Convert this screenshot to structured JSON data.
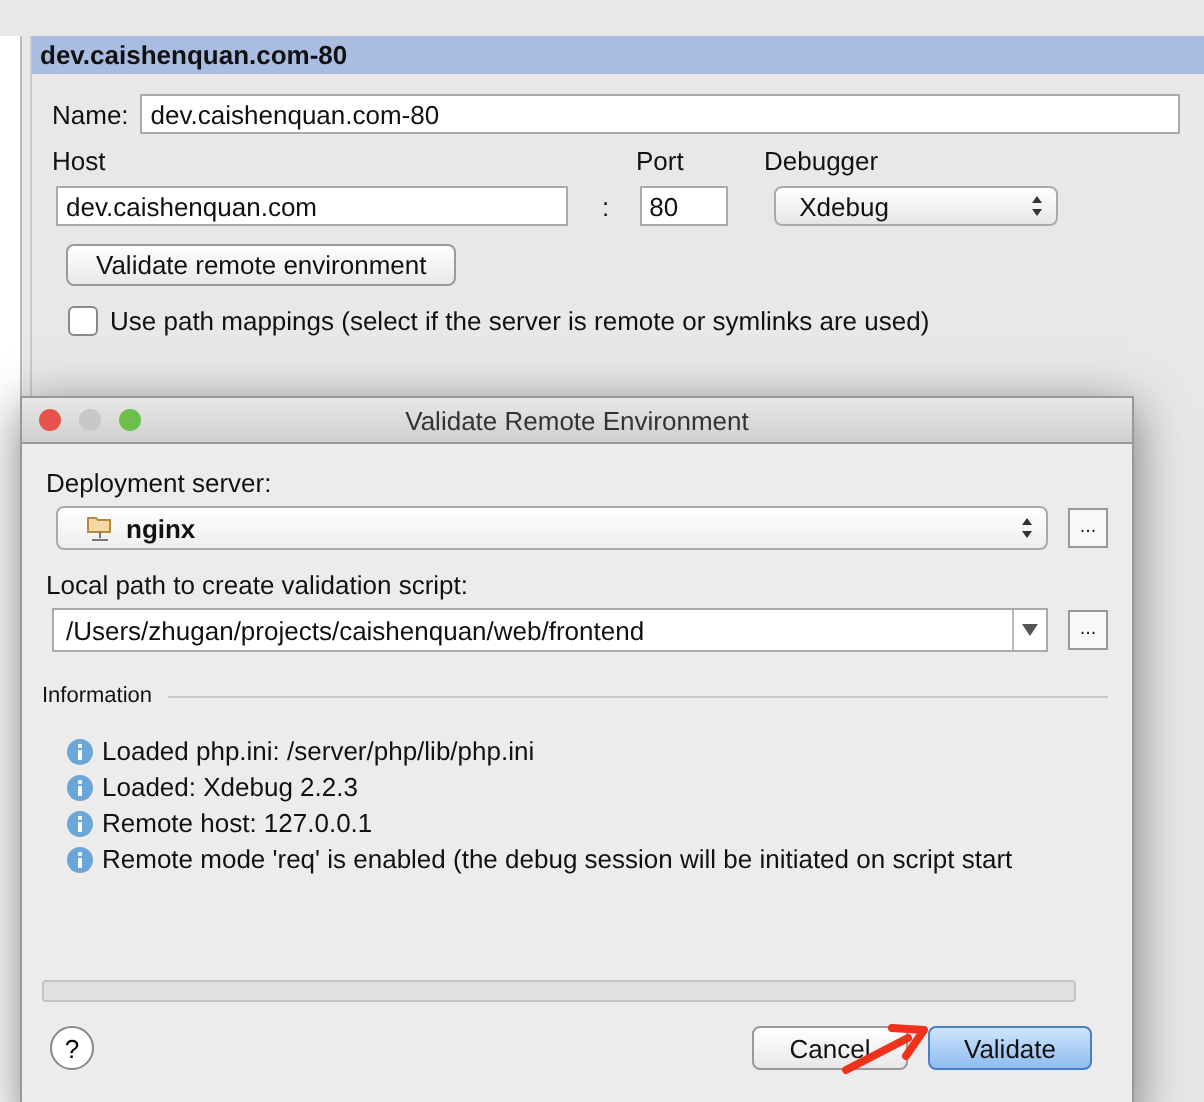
{
  "servers_panel": {
    "header": "dev.caishenquan.com-80",
    "name_label": "Name:",
    "name_value": "dev.caishenquan.com-80",
    "host_label": "Host",
    "host_value": "dev.caishenquan.com",
    "separator": ":",
    "port_label": "Port",
    "port_value": "80",
    "debugger_label": "Debugger",
    "debugger_value": "Xdebug",
    "validate_button": "Validate remote environment",
    "path_mappings": {
      "label": "Use path mappings (select if the server is remote or symlinks are used)",
      "checked": false
    }
  },
  "dialog": {
    "title": "Validate Remote Environment",
    "deployment_label": "Deployment server:",
    "deployment_value": "nginx",
    "deployment_browse": "...",
    "local_path_label": "Local path to create validation script:",
    "local_path_value": "/Users/zhugan/projects/caishenquan/web/frontend",
    "local_path_browse": "...",
    "information_title": "Information",
    "messages": [
      "Loaded php.ini: /server/php/lib/php.ini",
      "Loaded: Xdebug 2.2.3",
      "Remote host: 127.0.0.1",
      "Remote mode 'req' is enabled (the debug session will be initiated on script start"
    ],
    "progress": {
      "level": 0
    },
    "help": "?",
    "buttons": [
      {
        "label": "Cancel",
        "default": false
      },
      {
        "label": "Validate",
        "default": true
      }
    ]
  }
}
